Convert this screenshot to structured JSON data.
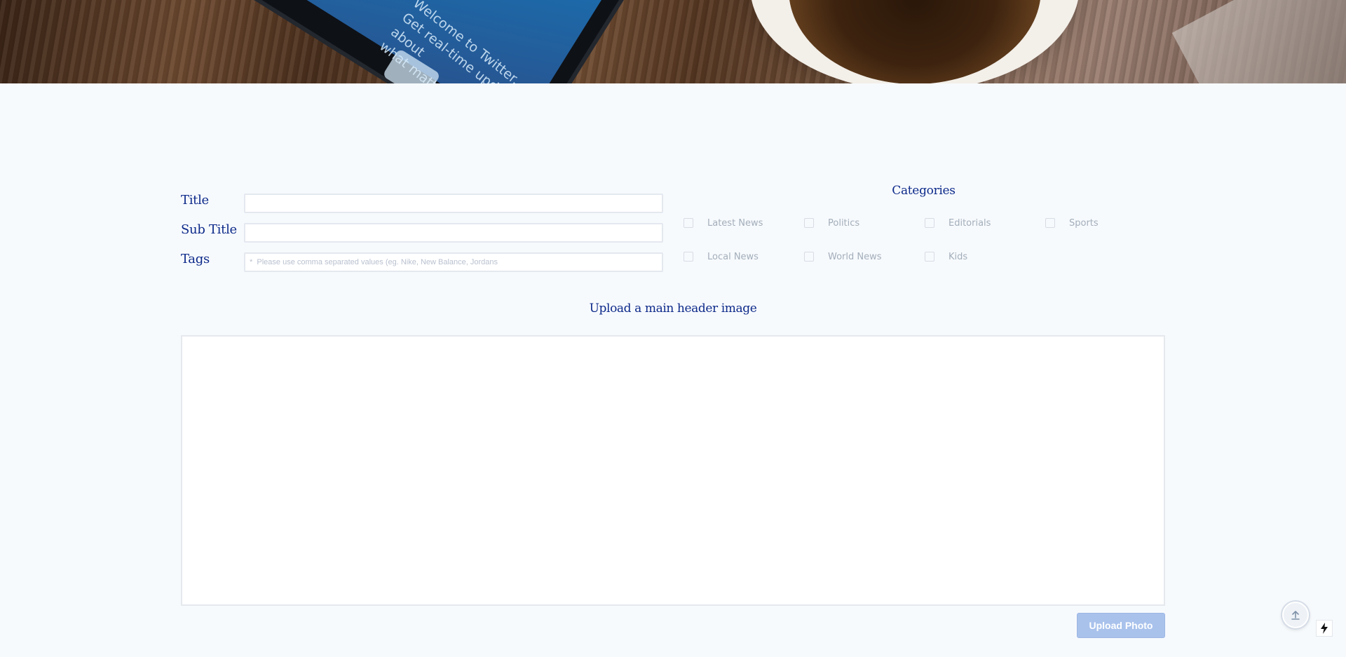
{
  "hero": {
    "phone_text": "Welcome to Twitter.\nGet real-time updates about\nwhat matters to you."
  },
  "form": {
    "title_label": "Title",
    "subtitle_label": "Sub Title",
    "tags_label": "Tags",
    "title_value": "",
    "subtitle_value": "",
    "tags_value": "",
    "tags_placeholder": "*  Please use comma separated values (eg. Nike, New Balance, Jordans"
  },
  "categories": {
    "title": "Categories",
    "items": [
      {
        "label": "Latest News",
        "checked": false
      },
      {
        "label": "Politics",
        "checked": false
      },
      {
        "label": "Editorials",
        "checked": false
      },
      {
        "label": "Sports",
        "checked": false
      },
      {
        "label": "Local News",
        "checked": false
      },
      {
        "label": "World News",
        "checked": false
      },
      {
        "label": "Kids",
        "checked": false
      }
    ]
  },
  "upload": {
    "heading": "Upload a main header image",
    "button_label": "Upload Photo"
  },
  "icons": {
    "scroll_top": "arrow-up-icon",
    "bolt": "lightning-bolt-icon"
  },
  "colors": {
    "accent": "#0d2a8a",
    "button": "#a9c2ec",
    "background": "#f7fafd"
  }
}
